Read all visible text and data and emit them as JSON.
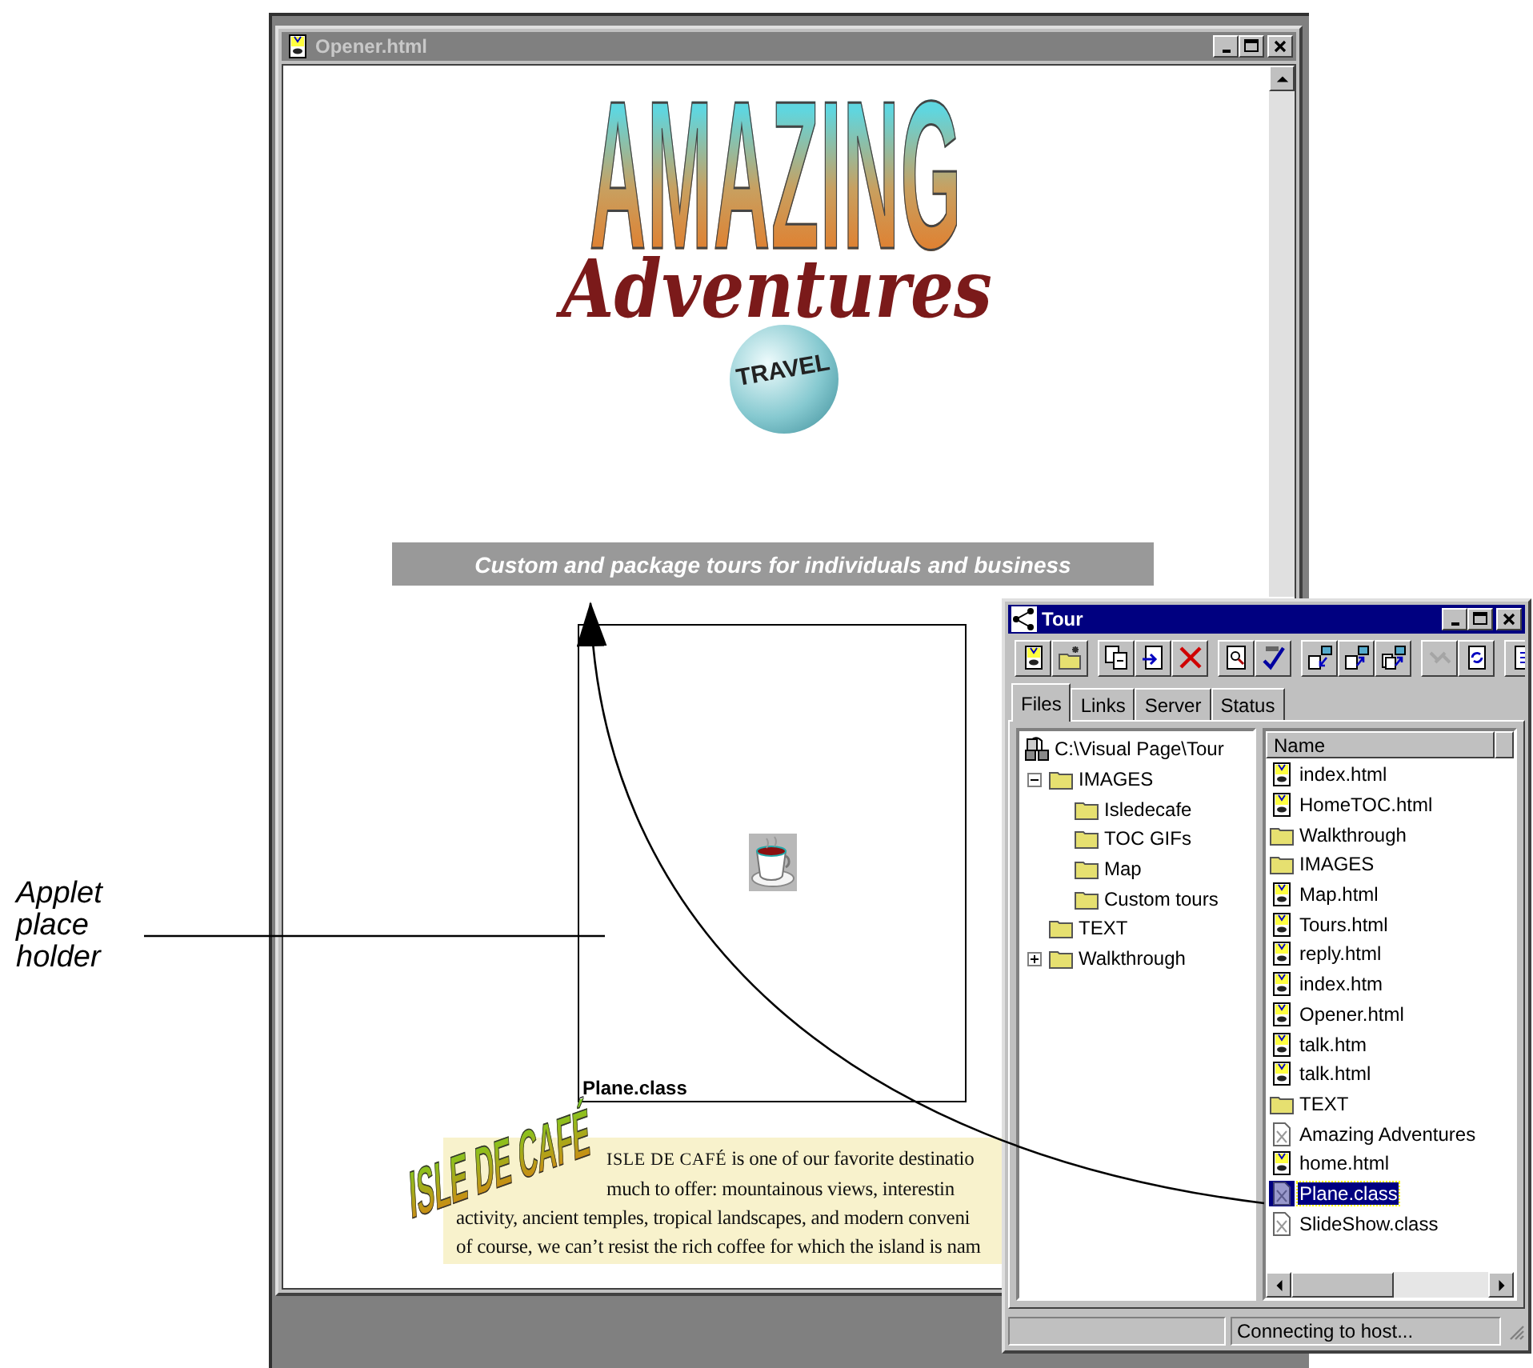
{
  "callout": {
    "label": "Applet place holder"
  },
  "document_window": {
    "title": "Opener.html",
    "active": false,
    "logo": {
      "line_1": "AMAZING",
      "line_2": "Adventures",
      "badge": "TRAVEL"
    },
    "tagline": "Custom and package tours for individuals and business",
    "applet": {
      "label": "Plane.class"
    },
    "article": {
      "logo": "ISLE DE CAFÉ",
      "lead": "ISLE DE CAFÉ",
      "lines": [
        " is one of our favorite destinatio",
        "much to offer: mountainous views, interestin",
        "activity, ancient temples, tropical landscapes, and modern conveni",
        "of course, we can’t resist the rich coffee for which the island is nam"
      ]
    }
  },
  "tour_window": {
    "title": "Tour",
    "active": true,
    "toolbar": [
      [
        {
          "kind": "page",
          "disabled": false
        },
        {
          "kind": "new_folder",
          "disabled": false
        }
      ],
      [
        {
          "kind": "copy",
          "disabled": false
        },
        {
          "kind": "import",
          "disabled": false
        },
        {
          "kind": "delete",
          "disabled": false
        }
      ],
      [
        {
          "kind": "find",
          "disabled": false
        },
        {
          "kind": "spell",
          "disabled": false
        }
      ],
      [
        {
          "kind": "get",
          "disabled": false
        },
        {
          "kind": "put",
          "disabled": false
        },
        {
          "kind": "sync",
          "disabled": false
        }
      ],
      [
        {
          "kind": "link",
          "disabled": true
        },
        {
          "kind": "refresh",
          "disabled": false
        }
      ],
      [
        {
          "kind": "extra",
          "disabled": false
        }
      ]
    ],
    "tabs": [
      {
        "label": "Files",
        "selected": true
      },
      {
        "label": "Links",
        "selected": false
      },
      {
        "label": "Server",
        "selected": false
      },
      {
        "label": "Status",
        "selected": false
      }
    ],
    "tree": {
      "label": "C:\\Visual Page\\Tour",
      "children": [
        {
          "label": "IMAGES",
          "expanded": true,
          "children": [
            {
              "label": "Isledecafe"
            },
            {
              "label": "TOC GIFs"
            },
            {
              "label": "Map"
            },
            {
              "label": "Custom tours"
            }
          ]
        },
        {
          "label": "TEXT"
        },
        {
          "label": "Walkthrough",
          "expanded": false
        }
      ]
    },
    "list": {
      "column": "Name",
      "rows": [
        {
          "name": "index.html",
          "kind": "page",
          "selected": false
        },
        {
          "name": "HomeTOC.html",
          "kind": "page",
          "selected": false
        },
        {
          "name": "Walkthrough",
          "kind": "folder",
          "selected": false
        },
        {
          "name": "IMAGES",
          "kind": "folder",
          "selected": false
        },
        {
          "name": "Map.html",
          "kind": "page",
          "selected": false
        },
        {
          "name": "Tours.html",
          "kind": "page",
          "selected": false
        },
        {
          "name": "reply.html",
          "kind": "page",
          "selected": false
        },
        {
          "name": "index.htm",
          "kind": "page",
          "selected": false
        },
        {
          "name": "Opener.html",
          "kind": "page",
          "selected": false
        },
        {
          "name": "talk.htm",
          "kind": "page",
          "selected": false
        },
        {
          "name": "talk.html",
          "kind": "page",
          "selected": false
        },
        {
          "name": "TEXT",
          "kind": "folder",
          "selected": false
        },
        {
          "name": "Amazing Adventures",
          "kind": "file",
          "selected": false
        },
        {
          "name": "home.html",
          "kind": "page",
          "selected": false
        },
        {
          "name": "Plane.class",
          "kind": "file",
          "selected": true
        },
        {
          "name": "SlideShow.class",
          "kind": "file",
          "selected": false
        }
      ]
    },
    "status_bar": {
      "message": "Connecting to host..."
    }
  }
}
